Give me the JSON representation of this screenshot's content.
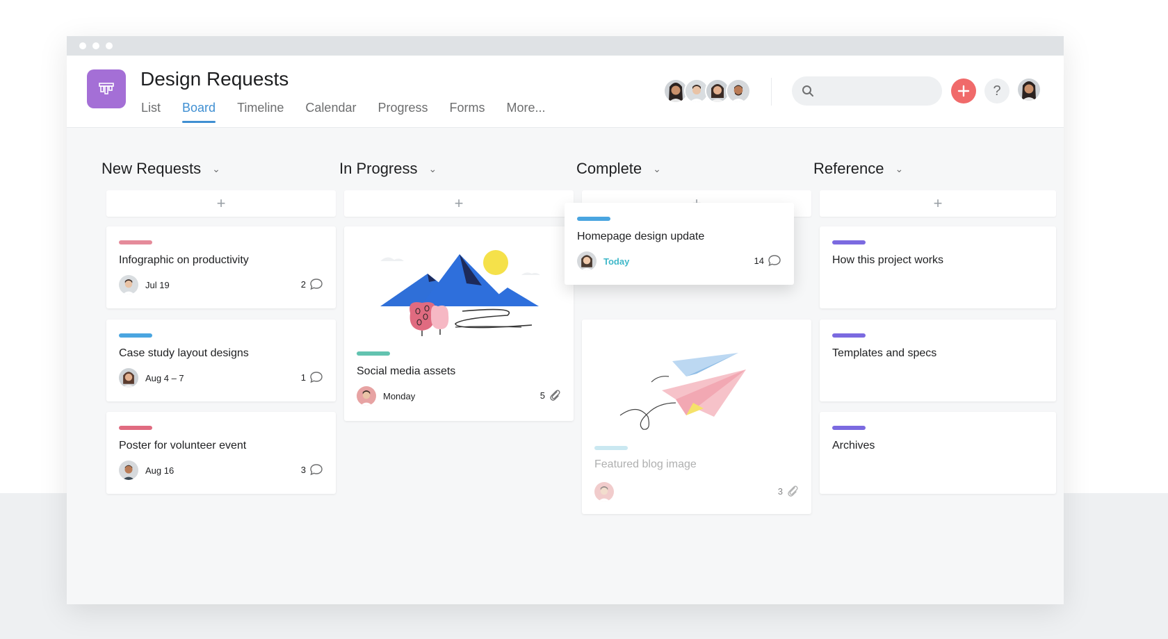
{
  "project": {
    "title": "Design Requests",
    "tabs": [
      "List",
      "Board",
      "Timeline",
      "Calendar",
      "Progress",
      "Forms",
      "More..."
    ],
    "active_tab": "Board",
    "accent": "#3f8fd2",
    "icon_color": "#a46fd6"
  },
  "header": {
    "search_placeholder": "",
    "help_label": "?",
    "members": [
      "member-1",
      "member-2",
      "member-3",
      "member-4"
    ]
  },
  "columns": [
    {
      "title": "New Requests",
      "add": "+"
    },
    {
      "title": "In Progress",
      "add": "+"
    },
    {
      "title": "Complete",
      "add": "+"
    },
    {
      "title": "Reference",
      "add": "+"
    }
  ],
  "cards": {
    "infographic": {
      "title": "Infographic on productivity",
      "date": "Jul 19",
      "count": "2",
      "tag_color": "#e58b9a"
    },
    "case_study": {
      "title": "Case study layout designs",
      "date": "Aug 4 – 7",
      "count": "1",
      "tag_color": "#4aa5e0"
    },
    "poster": {
      "title": "Poster for volunteer event",
      "date": "Aug 16",
      "count": "3",
      "tag_color": "#e06b80"
    },
    "social": {
      "title": "Social media assets",
      "date": "Monday",
      "count": "5",
      "tag_color": "#62c3b0"
    },
    "homepage": {
      "title": "Homepage design update",
      "date": "Today",
      "count": "14",
      "tag_color": "#4aa5e0",
      "date_color": "#3fb8c9"
    },
    "blog": {
      "title": "Featured blog image",
      "date": "",
      "count": "3",
      "tag_color": "#9fd6e6"
    },
    "how": {
      "title": "How this project works",
      "tag_color": "#7b6ae0"
    },
    "templates": {
      "title": "Templates and specs",
      "tag_color": "#7b6ae0"
    },
    "archives": {
      "title": "Archives",
      "tag_color": "#7b6ae0"
    }
  }
}
